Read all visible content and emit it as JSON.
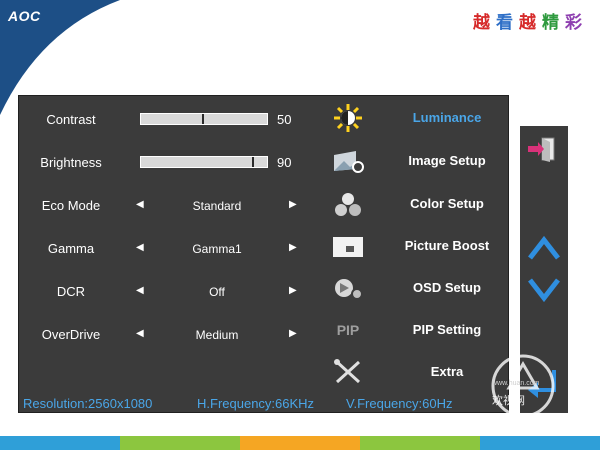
{
  "brand": {
    "logo": "AOC",
    "slogan_chars": [
      "越",
      "看",
      "越",
      "精",
      "彩"
    ],
    "slogan_colors": [
      "#d62a2a",
      "#2e6fc7",
      "#d62a2a",
      "#2e9a3e",
      "#8e3fb0"
    ],
    "corner_color": "#1d4f86"
  },
  "osd": {
    "settings": [
      {
        "label": "Contrast",
        "type": "slider",
        "value": "50",
        "level": 0.5
      },
      {
        "label": "Brightness",
        "type": "slider",
        "value": "90",
        "level": 0.9
      },
      {
        "label": "Eco Mode",
        "type": "select",
        "value": "Standard"
      },
      {
        "label": "Gamma",
        "type": "select",
        "value": "Gamma1"
      },
      {
        "label": "DCR",
        "type": "select",
        "value": "Off"
      },
      {
        "label": "OverDrive",
        "type": "select",
        "value": "Medium"
      }
    ],
    "menu": [
      {
        "label": "Luminance",
        "icon": "sun-icon",
        "active": true
      },
      {
        "label": "Image Setup",
        "icon": "image-setup-icon",
        "active": false
      },
      {
        "label": "Color Setup",
        "icon": "color-setup-icon",
        "active": false
      },
      {
        "label": "Picture Boost",
        "icon": "picture-boost-icon",
        "active": false
      },
      {
        "label": "OSD Setup",
        "icon": "osd-setup-icon",
        "active": false
      },
      {
        "label": "PIP Setting",
        "icon": "pip-icon",
        "icon_text": "PIP",
        "active": false
      },
      {
        "label": "Extra",
        "icon": "tools-icon",
        "active": false
      }
    ],
    "status": {
      "resolution": "Resolution:2560x1080",
      "hfreq": "H.Frequency:66KHz",
      "vfreq": "V.Frequency:60Hz"
    },
    "accent_color": "#4aa6e8"
  },
  "side_nav": {
    "buttons": [
      "exit-icon",
      "up-arrow-icon",
      "down-arrow-icon",
      "enter-icon"
    ]
  },
  "watermark": {
    "text": "欢视网",
    "url": "www.huan.com"
  },
  "strip_colors": [
    "#2f9fd8",
    "#8cc63f",
    "#f5a623",
    "#8cc63f",
    "#2f9fd8"
  ]
}
